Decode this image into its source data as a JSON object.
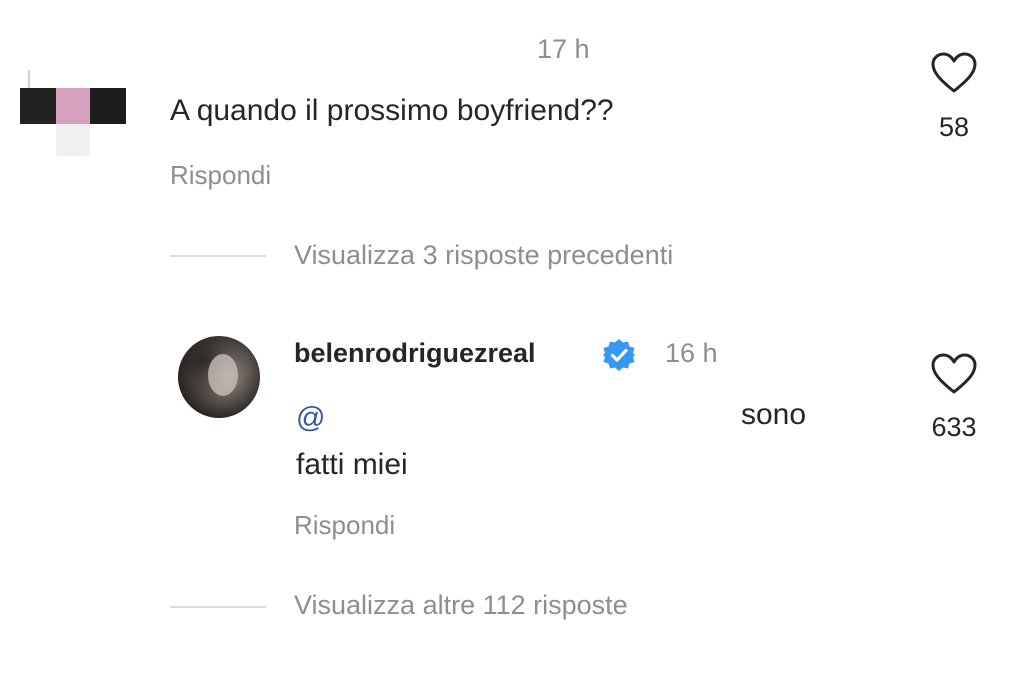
{
  "top_comment": {
    "time": "17 h",
    "text": "A quando il prossimo boyfriend??",
    "reply_label": "Rispondi",
    "likes": "58"
  },
  "thread": {
    "view_previous": "Visualizza 3 risposte precedenti",
    "view_more": "Visualizza altre 112 risposte"
  },
  "reply": {
    "username": "belenrodriguezreal",
    "time": "16 h",
    "mention": "@",
    "text_part1": "sono",
    "text_part2": "fatti miei",
    "reply_label": "Rispondi",
    "likes": "633"
  },
  "icons": {
    "heart": "heart-icon",
    "verified": "verified-badge-icon"
  },
  "colors": {
    "verified": "#3897f0",
    "mention": "#385898",
    "secondary_text": "#8e8e8e"
  }
}
